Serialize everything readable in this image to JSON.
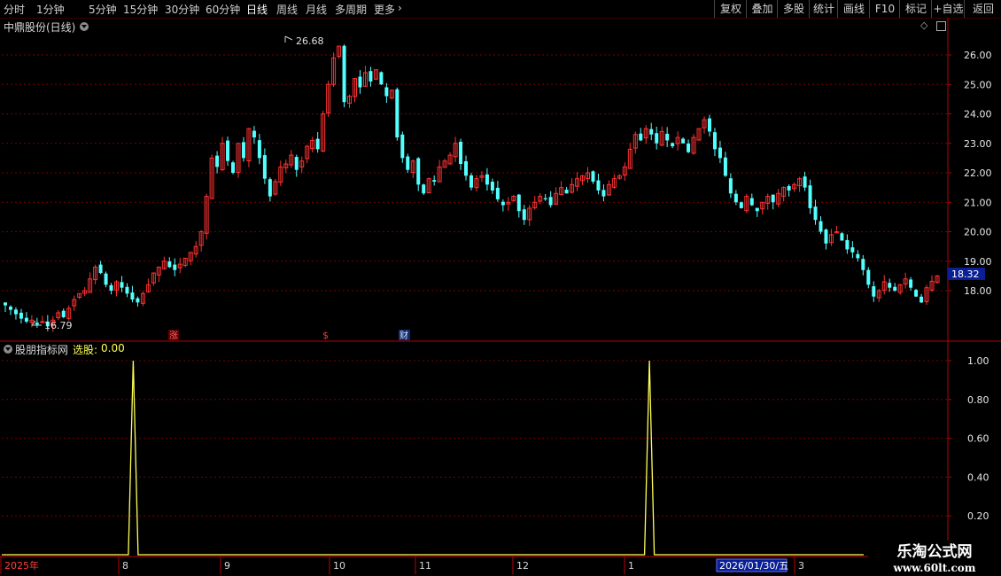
{
  "toolbar": {
    "tabs": [
      "分时",
      "1分钟",
      "5分钟",
      "15分钟",
      "30分钟",
      "60分钟",
      "日线",
      "周线",
      "月线",
      "多周期",
      "更多"
    ],
    "active_tab": "日线",
    "right_buttons": [
      "复权",
      "叠加",
      "多股",
      "统计",
      "画线",
      "F10",
      "标记",
      "+自选",
      "返回"
    ]
  },
  "main_panel": {
    "title": "中鼎股份(日线)",
    "high_label": "26.68",
    "low_label": "16.79",
    "current_price": "18.32",
    "markers": [
      "涨",
      "$",
      "财"
    ]
  },
  "indicator_panel": {
    "name": "股朋指标网",
    "label": "选股:",
    "value": "0.00"
  },
  "time_axis": {
    "labels": [
      "2025年",
      "8",
      "9",
      "10",
      "11",
      "12",
      "1",
      "3"
    ],
    "cursor_date": "2026/01/30/五"
  },
  "watermark": {
    "line1": "乐淘公式网",
    "line2": "www.60lt.com"
  },
  "colors": {
    "up": "#ff3232",
    "down": "#54ffff",
    "indicator": "#ffff54",
    "grid": "#7a0000",
    "axis": "#c00000"
  },
  "chart_data": [
    {
      "type": "candlestick",
      "title": "中鼎股份(日线)",
      "ylim": [
        16.4,
        26.9
      ],
      "yticks": [
        18,
        19,
        20,
        21,
        22,
        23,
        24,
        25,
        26
      ],
      "x_axis_labels": [
        "2025年",
        "8",
        "9",
        "10",
        "11",
        "12",
        "1",
        "3"
      ],
      "annotations": {
        "high": 26.68,
        "low": 16.79,
        "last": 18.32
      },
      "close": [
        17.5,
        17.35,
        17.2,
        17.05,
        16.95,
        17.0,
        16.85,
        16.95,
        16.79,
        17.0,
        17.25,
        17.1,
        17.4,
        17.7,
        17.9,
        18.0,
        18.4,
        18.8,
        18.6,
        18.2,
        18.0,
        18.3,
        18.1,
        17.9,
        17.7,
        17.6,
        17.9,
        18.2,
        18.6,
        18.8,
        19.0,
        18.8,
        18.7,
        18.9,
        19.1,
        19.3,
        19.5,
        20.0,
        21.2,
        22.5,
        22.2,
        23.0,
        22.4,
        22.0,
        23.0,
        22.5,
        23.5,
        23.2,
        22.5,
        21.8,
        21.2,
        21.7,
        22.2,
        22.3,
        22.6,
        22.1,
        22.4,
        22.9,
        23.1,
        22.8,
        24.0,
        25.0,
        25.9,
        26.3,
        24.4,
        24.6,
        25.2,
        24.9,
        25.4,
        25.1,
        25.5,
        25.0,
        24.6,
        24.8,
        23.2,
        22.5,
        22.1,
        22.4,
        21.6,
        21.3,
        21.8,
        21.7,
        22.2,
        22.4,
        22.6,
        23.0,
        22.3,
        21.9,
        21.5,
        21.8,
        21.9,
        21.6,
        21.4,
        21.1,
        20.9,
        21.0,
        21.2,
        20.7,
        20.4,
        20.8,
        21.0,
        21.2,
        21.1,
        20.9,
        21.3,
        21.5,
        21.3,
        21.6,
        21.8,
        21.9,
        22.0,
        21.7,
        21.4,
        21.2,
        21.6,
        21.8,
        21.9,
        22.2,
        22.8,
        23.3,
        23.1,
        23.5,
        23.3,
        23.0,
        23.4,
        23.1,
        22.9,
        23.2,
        23.0,
        22.7,
        23.2,
        23.5,
        23.8,
        23.4,
        22.8,
        22.5,
        21.9,
        21.3,
        21.0,
        20.8,
        21.2,
        20.9,
        20.7,
        21.0,
        21.2,
        21.0,
        21.3,
        21.5,
        21.4,
        21.6,
        21.8,
        21.5,
        20.8,
        20.4,
        20.0,
        19.6,
        19.9,
        20.0,
        19.7,
        19.4,
        19.3,
        19.1,
        18.7,
        18.2,
        17.8,
        18.0,
        18.3,
        18.1,
        18.0,
        18.2,
        18.4,
        18.1,
        17.8,
        17.6,
        18.1,
        18.32,
        18.5
      ],
      "volatility": 0.2
    },
    {
      "type": "line",
      "name": "股朋指标网",
      "series_name": "选股",
      "ylim": [
        0,
        1.04
      ],
      "yticks": [
        0.2,
        0.4,
        0.6,
        0.8,
        1.0
      ],
      "points": 178,
      "spikes": [
        {
          "index": 27,
          "value": 1.0
        },
        {
          "index": 133,
          "value": 1.0
        }
      ],
      "baseline": 0.0
    }
  ]
}
